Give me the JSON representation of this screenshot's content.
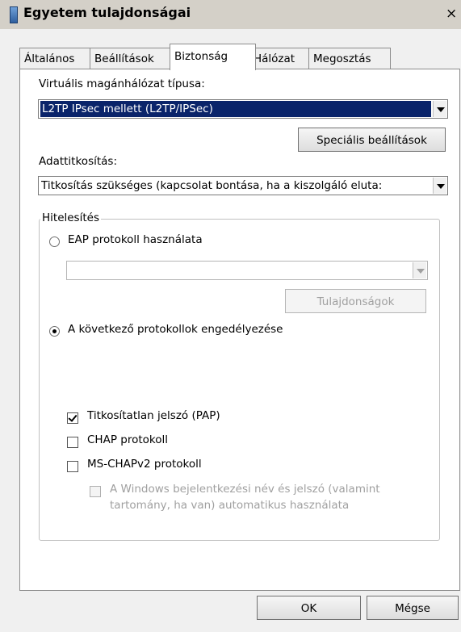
{
  "window": {
    "title": "Egyetem tulajdonságai",
    "close_glyph": "×"
  },
  "tabs": [
    {
      "label": "Általános"
    },
    {
      "label": "Beállítások"
    },
    {
      "label": "Biztonság"
    },
    {
      "label": "Hálózat"
    },
    {
      "label": "Megosztás"
    }
  ],
  "active_tab": "Biztonság",
  "vpn": {
    "label": "Virtuális magánhálózat típusa:",
    "value": "L2TP IPsec mellett (L2TP/IPSec)",
    "advanced_button": "Speciális beállítások"
  },
  "encryption": {
    "label": "Adattitkosítás:",
    "value": "Titkosítás szükséges (kapcsolat bontása, ha a kiszolgáló eluta:"
  },
  "authentication": {
    "legend": "Hitelesítés",
    "eap_radio": {
      "label": "EAP protokoll használata",
      "checked": false
    },
    "eap_combo_value": "",
    "properties_button": "Tulajdonságok",
    "allow_radio": {
      "label": "A következő protokollok engedélyezése",
      "checked": true
    },
    "pap": {
      "label": "Titkosítatlan jelszó (PAP)",
      "checked": true
    },
    "chap": {
      "label": "CHAP protokoll",
      "checked": false
    },
    "mschap": {
      "label": "MS-CHAPv2  protokoll",
      "checked": false
    },
    "windows_logon": {
      "line1": "A Windows bejelentkezési név és jelszó (valamint",
      "line2": "tartomány, ha van) automatikus használata",
      "checked": false
    }
  },
  "footer": {
    "ok": "OK",
    "cancel": "Mégse"
  },
  "colors": {
    "selection": "#0a246a",
    "panel": "#ffffff",
    "chrome": "#f0f0f0"
  }
}
